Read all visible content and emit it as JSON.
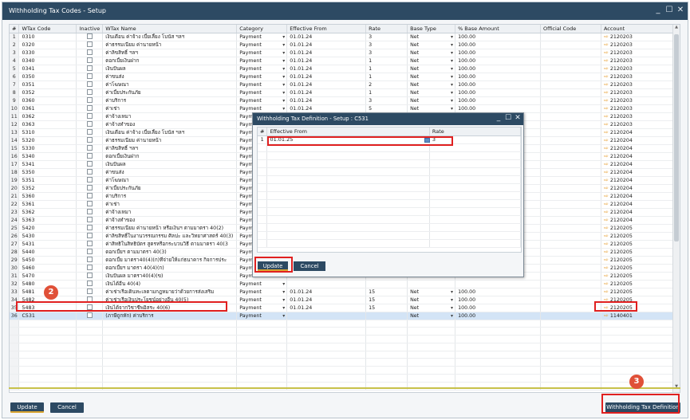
{
  "window": {
    "title": "Withholding Tax Codes - Setup"
  },
  "columns": [
    "#",
    "WTax Code",
    "Inactive",
    "WTax Name",
    "Category",
    "Effective From",
    "Rate",
    "Base Type",
    "% Base Amount",
    "Official Code",
    "Account"
  ],
  "rows": [
    {
      "n": "1",
      "code": "0310",
      "name": "เงินเดือน ค่าจ้าง เบี้ยเลี้ยง โบนัส ฯลฯ",
      "cat": "Payment",
      "eff": "01.01.24",
      "rate": "3",
      "base": "Net",
      "pct": "100.00",
      "acc": "2120203"
    },
    {
      "n": "2",
      "code": "0320",
      "name": "ค่าธรรมเนียม ค่านายหน้า",
      "cat": "Payment",
      "eff": "01.01.24",
      "rate": "3",
      "base": "Net",
      "pct": "100.00",
      "acc": "2120203"
    },
    {
      "n": "3",
      "code": "0330",
      "name": "ค่าลิขสิทธิ์ ฯลฯ",
      "cat": "Payment",
      "eff": "01.01.24",
      "rate": "3",
      "base": "Net",
      "pct": "100.00",
      "acc": "2120203"
    },
    {
      "n": "4",
      "code": "0340",
      "name": "ดอกเบี้ยเงินฝาก",
      "cat": "Payment",
      "eff": "01.01.24",
      "rate": "1",
      "base": "Net",
      "pct": "100.00",
      "acc": "2120203"
    },
    {
      "n": "5",
      "code": "0341",
      "name": "เงินปันผล",
      "cat": "Payment",
      "eff": "01.01.24",
      "rate": "1",
      "base": "Net",
      "pct": "100.00",
      "acc": "2120203"
    },
    {
      "n": "6",
      "code": "0350",
      "name": "ค่าขนส่ง",
      "cat": "Payment",
      "eff": "01.01.24",
      "rate": "1",
      "base": "Net",
      "pct": "100.00",
      "acc": "2120203"
    },
    {
      "n": "7",
      "code": "0351",
      "name": "ค่าโฆษณา",
      "cat": "Payment",
      "eff": "01.01.24",
      "rate": "2",
      "base": "Net",
      "pct": "100.00",
      "acc": "2120203"
    },
    {
      "n": "8",
      "code": "0352",
      "name": "ค่าเบี้ยประกันภัย",
      "cat": "Payment",
      "eff": "01.01.24",
      "rate": "1",
      "base": "Net",
      "pct": "100.00",
      "acc": "2120203"
    },
    {
      "n": "9",
      "code": "0360",
      "name": "ค่าบริการ",
      "cat": "Payment",
      "eff": "01.01.24",
      "rate": "3",
      "base": "Net",
      "pct": "100.00",
      "acc": "2120203"
    },
    {
      "n": "10",
      "code": "0361",
      "name": "ค่าเช่า",
      "cat": "Payment",
      "eff": "01.01.24",
      "rate": "5",
      "base": "Net",
      "pct": "100.00",
      "acc": "2120203"
    },
    {
      "n": "11",
      "code": "0362",
      "name": "ค่าจ้างเหมา",
      "cat": "Payment",
      "eff": "",
      "rate": "",
      "base": "",
      "pct": "",
      "acc": "2120203"
    },
    {
      "n": "12",
      "code": "0363",
      "name": "ค่าจ้างทำของ",
      "cat": "Payment",
      "eff": "",
      "rate": "",
      "base": "",
      "pct": "",
      "acc": "2120203"
    },
    {
      "n": "13",
      "code": "5310",
      "name": "เงินเดือน ค่าจ้าง เบี้ยเลี้ยง โบนัส ฯลฯ",
      "cat": "Payment",
      "eff": "",
      "rate": "",
      "base": "",
      "pct": "",
      "acc": "2120204"
    },
    {
      "n": "14",
      "code": "5320",
      "name": "ค่าธรรมเนียม ค่านายหน้า",
      "cat": "Payment",
      "eff": "",
      "rate": "",
      "base": "",
      "pct": "",
      "acc": "2120204"
    },
    {
      "n": "15",
      "code": "5330",
      "name": "ค่าลิขสิทธิ์ ฯลฯ",
      "cat": "Payment",
      "eff": "",
      "rate": "",
      "base": "",
      "pct": "",
      "acc": "2120204"
    },
    {
      "n": "16",
      "code": "5340",
      "name": "ดอกเบี้ยเงินฝาก",
      "cat": "Payment",
      "eff": "",
      "rate": "",
      "base": "",
      "pct": "",
      "acc": "2120204"
    },
    {
      "n": "17",
      "code": "5341",
      "name": "เงินปันผล",
      "cat": "Payment",
      "eff": "",
      "rate": "",
      "base": "",
      "pct": "",
      "acc": "2120204"
    },
    {
      "n": "18",
      "code": "5350",
      "name": "ค่าขนส่ง",
      "cat": "Payment",
      "eff": "",
      "rate": "",
      "base": "",
      "pct": "",
      "acc": "2120204"
    },
    {
      "n": "19",
      "code": "5351",
      "name": "ค่าโฆษณา",
      "cat": "Payment",
      "eff": "",
      "rate": "",
      "base": "",
      "pct": "",
      "acc": "2120204"
    },
    {
      "n": "20",
      "code": "5352",
      "name": "ค่าเบี้ยประกันภัย",
      "cat": "Payment",
      "eff": "",
      "rate": "",
      "base": "",
      "pct": "",
      "acc": "2120204"
    },
    {
      "n": "21",
      "code": "5360",
      "name": "ค่าบริการ",
      "cat": "Payment",
      "eff": "",
      "rate": "",
      "base": "",
      "pct": "",
      "acc": "2120204"
    },
    {
      "n": "22",
      "code": "5361",
      "name": "ค่าเช่า",
      "cat": "Payment",
      "eff": "",
      "rate": "",
      "base": "",
      "pct": "",
      "acc": "2120204"
    },
    {
      "n": "23",
      "code": "5362",
      "name": "ค่าจ้างเหมา",
      "cat": "Payment",
      "eff": "",
      "rate": "",
      "base": "",
      "pct": "",
      "acc": "2120204"
    },
    {
      "n": "24",
      "code": "5363",
      "name": "ค่าจ้างทำของ",
      "cat": "Payment",
      "eff": "",
      "rate": "",
      "base": "",
      "pct": "",
      "acc": "2120204"
    },
    {
      "n": "25",
      "code": "5420",
      "name": "ค่าธรรมเนียม ค่านายหน้า หรือเงินฯ ตามมาตรา 40(2)",
      "cat": "Payment",
      "eff": "",
      "rate": "",
      "base": "",
      "pct": "",
      "acc": "2120205"
    },
    {
      "n": "26",
      "code": "5430",
      "name": "ค่าลิขสิทธิ์ในงานวรรณกรรม ศิลปะ และวิทยาศาสตร์ 40(3)",
      "cat": "Payment",
      "eff": "",
      "rate": "",
      "base": "",
      "pct": "",
      "acc": "2120205"
    },
    {
      "n": "27",
      "code": "5431",
      "name": "ค่าสิทธิในสิทธิบัตร สูตรหรือกระบวนวิธี ตามมาตรา 40(3",
      "cat": "Payment",
      "eff": "",
      "rate": "",
      "base": "",
      "pct": "",
      "acc": "2120205"
    },
    {
      "n": "28",
      "code": "5440",
      "name": "ดอกเบี้ยฯ ตามมาตรา 40(3)",
      "cat": "Payment",
      "eff": "",
      "rate": "",
      "base": "",
      "pct": "",
      "acc": "2120205"
    },
    {
      "n": "29",
      "code": "5450",
      "name": "ดอกเบี้ย มาตรา40(4)(ก)ที่จ่ายให้แก่ธนาคาร กิจการประ",
      "cat": "Payment",
      "eff": "",
      "rate": "",
      "base": "",
      "pct": "",
      "acc": "2120205"
    },
    {
      "n": "30",
      "code": "5460",
      "name": "ดอกเบี้ยฯ มาตรา 40(4)(ก)",
      "cat": "Payment",
      "eff": "",
      "rate": "",
      "base": "",
      "pct": "",
      "acc": "2120205"
    },
    {
      "n": "31",
      "code": "5470",
      "name": "เงินปันผล มาตรา40(4)(ข)",
      "cat": "Payment",
      "eff": "",
      "rate": "",
      "base": "",
      "pct": "",
      "acc": "2120205"
    },
    {
      "n": "32",
      "code": "5480",
      "name": "เงินได้อื่น 40(4)",
      "cat": "Payment",
      "eff": "",
      "rate": "",
      "base": "",
      "pct": "",
      "acc": "2120205"
    },
    {
      "n": "33",
      "code": "5481",
      "name": "ค่าเช่าเรือเดินทะเลตามกฎหมายว่าด้วยการส่งเสริม",
      "cat": "Payment",
      "eff": "01.01.24",
      "rate": "15",
      "base": "Net",
      "pct": "100.00",
      "acc": "2120205"
    },
    {
      "n": "34",
      "code": "5482",
      "name": "ค่าเช่าเรือเงินประโยชน์อย่างอื่น 40(5)",
      "cat": "Payment",
      "eff": "01.01.24",
      "rate": "15",
      "base": "Net",
      "pct": "100.00",
      "acc": "2120205"
    },
    {
      "n": "35",
      "code": "5483",
      "name": "เงินได้จากวิชาชีพอิสระ 40(6)",
      "cat": "Payment",
      "eff": "01.01.24",
      "rate": "15",
      "base": "Net",
      "pct": "100.00",
      "acc": "2120205"
    },
    {
      "n": "36",
      "code": "C531",
      "name": "(ภาษีถูกหัก) ค่าบริการ",
      "cat": "Payment",
      "eff": "",
      "rate": "",
      "base": "Net",
      "pct": "100.00",
      "acc": "1140401"
    }
  ],
  "buttons": {
    "update": "Update",
    "cancel": "Cancel",
    "wtd": "Withholding Tax Definition"
  },
  "badges": {
    "b2": "2",
    "b3": "3"
  },
  "dialog": {
    "title": "Withholding Tax Definition - Setup : C531",
    "col_num": "#",
    "col_eff": "Effective From",
    "col_rate": "Rate",
    "row_num": "1",
    "row_eff": "01.01.25",
    "row_rate": "3",
    "update": "Update",
    "cancel": "Cancel"
  },
  "colors": {
    "titlebar": "#2d4a63",
    "highlight": "#e02020",
    "selected_row": "#d3e4f6",
    "account_arrow": "#e8a33a"
  }
}
